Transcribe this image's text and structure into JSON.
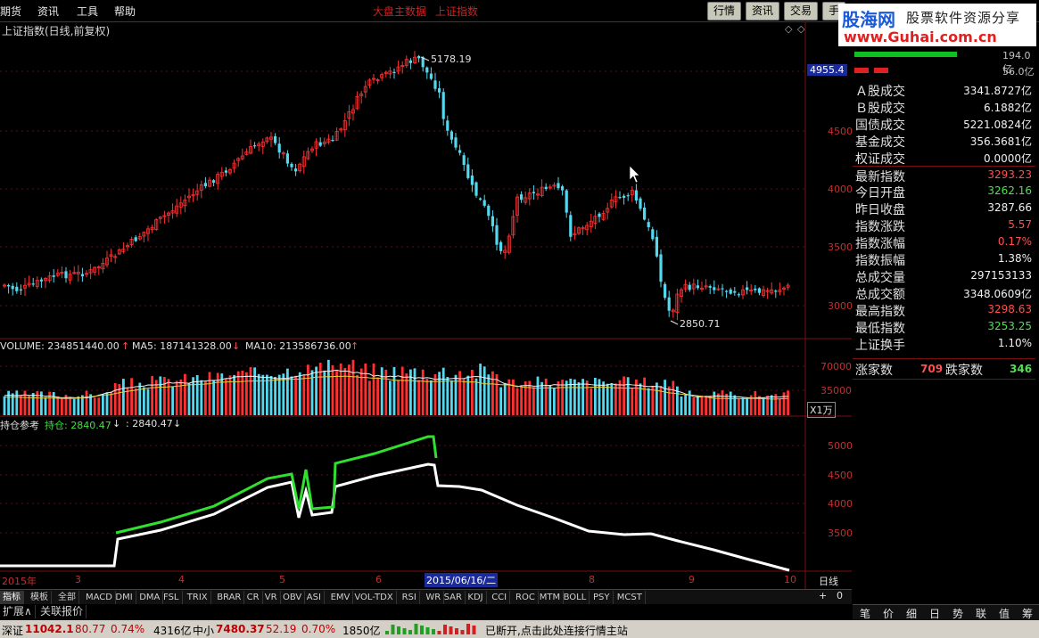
{
  "menu": {
    "items": [
      "期货",
      "资讯",
      "工具",
      "帮助"
    ],
    "center_items": [
      "大盘主数据",
      "上证指数"
    ],
    "right_buttons": [
      "行情",
      "资讯",
      "交易",
      "手"
    ]
  },
  "logo": {
    "brand": "股海网",
    "slogan": "股票软件资源分享",
    "url": "www.Guhai.com.cn"
  },
  "chart_title": "上证指数(日线,前复权)",
  "price_axis": {
    "ticks": [
      "4955.4",
      "4500",
      "4000",
      "3500",
      "3000"
    ],
    "current_label": "4955.4"
  },
  "price_annotations": {
    "high": "5178.19",
    "low": "2850.71"
  },
  "volume_header": {
    "volume": "VOLUME: 234851440.00",
    "ma5": "MA5: 187141328.00",
    "ma10": "MA10: 213586736.00"
  },
  "volume_axis": {
    "ticks": [
      "70000",
      "35000"
    ],
    "unit": "X1万"
  },
  "position_header": {
    "label": "持仓参考",
    "hold": "持仓: 2840.47",
    "value": ": 2840.47"
  },
  "position_axis": {
    "ticks": [
      "5000",
      "4500",
      "4000",
      "3500"
    ]
  },
  "date_axis": {
    "year": "2015年",
    "months": [
      "3",
      "4",
      "5",
      "6",
      "8",
      "9",
      "10"
    ],
    "cursor_date": "2015/06/16/二",
    "period": "日线"
  },
  "indicator_tabs": [
    "指标",
    "模板",
    "全部",
    "MACD",
    "DMI",
    "DMA",
    "FSL",
    "TRIX",
    "BRAR",
    "CR",
    "VR",
    "OBV",
    "ASI",
    "EMV",
    "VOL-TDX",
    "RSI",
    "WR",
    "SAR",
    "KDJ",
    "CCI",
    "ROC",
    "MTM",
    "BOLL",
    "PSY",
    "MCST"
  ],
  "sub_tabs": [
    "扩展∧",
    "关联报价"
  ],
  "zoom_controls": [
    "+",
    "0"
  ],
  "right_panel": {
    "top_values": [
      "194.0亿",
      "56.0亿"
    ],
    "rows": [
      {
        "k": "Ａ股成交",
        "v": "3341.8727亿",
        "c": "white"
      },
      {
        "k": "Ｂ股成交",
        "v": "6.1882亿",
        "c": "white"
      },
      {
        "k": "国债成交",
        "v": "5221.0824亿",
        "c": "white"
      },
      {
        "k": "基金成交",
        "v": "356.3681亿",
        "c": "white"
      },
      {
        "k": "权证成交",
        "v": "0.0000亿",
        "c": "white"
      },
      {
        "k": "最新指数",
        "v": "3293.23",
        "c": "red"
      },
      {
        "k": "今日开盘",
        "v": "3262.16",
        "c": "green"
      },
      {
        "k": "昨日收盘",
        "v": "3287.66",
        "c": "white"
      },
      {
        "k": "指数涨跌",
        "v": "5.57",
        "c": "red"
      },
      {
        "k": "指数涨幅",
        "v": "0.17%",
        "c": "red"
      },
      {
        "k": "指数振幅",
        "v": "1.38%",
        "c": "white"
      },
      {
        "k": "总成交量",
        "v": "297153133",
        "c": "white"
      },
      {
        "k": "总成交额",
        "v": "3348.0609亿",
        "c": "white"
      },
      {
        "k": "最高指数",
        "v": "3298.63",
        "c": "red"
      },
      {
        "k": "最低指数",
        "v": "3253.25",
        "c": "green"
      },
      {
        "k": "上证换手",
        "v": "1.10%",
        "c": "white"
      }
    ],
    "rise_label": "涨家数",
    "rise_count": "709",
    "fall_label": "跌家数",
    "fall_count": "346",
    "bottom_tabs": [
      "笔",
      "价",
      "细",
      "日",
      "势",
      "联",
      "值",
      "筹"
    ]
  },
  "status_bar": {
    "sz_name": "深证",
    "sz_value": "11042.1",
    "sz_change": "80.77",
    "sz_pct": "0.74%",
    "sz_amount": "4316亿",
    "zx_name": "中小",
    "zx_value": "7480.37",
    "zx_change": "52.19",
    "zx_pct": "0.70%",
    "zx_amount": "1850亿",
    "message": "已断开,点击此处连接行情主站"
  },
  "colors": {
    "up": "#ff3030",
    "down": "#54d8f0",
    "grid": "#7a1010",
    "hold_line": "#30e030"
  }
}
